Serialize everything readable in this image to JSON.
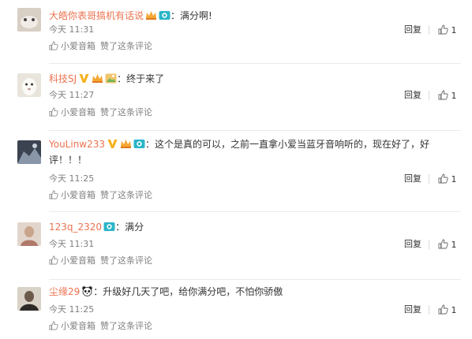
{
  "comments": [
    {
      "username": "大皓你表哥搞机有话说",
      "text": "：满分啊!",
      "time": "今天 11:31",
      "reply": "回复",
      "likes": "1",
      "source": "小爱音箱",
      "liked_label": "赞了这条评论"
    },
    {
      "username": "科技SJ",
      "text": "：终于来了",
      "time": "今天 11:27",
      "reply": "回复",
      "likes": "1",
      "source": "小爱音箱",
      "liked_label": "赞了这条评论"
    },
    {
      "username": "YouLinw233",
      "text": "：这个是真的可以，之前一直拿小爱当蓝牙音响听的，现在好了，好评！！！",
      "time": "今天 11:25",
      "reply": "回复",
      "likes": "1",
      "source": "小爱音箱",
      "liked_label": "赞了这条评论"
    },
    {
      "username": "123q_2320",
      "text": "：满分",
      "time": "今天 11:31",
      "reply": "回复",
      "likes": "1",
      "source": "小爱音箱",
      "liked_label": "赞了这条评论"
    },
    {
      "username": "尘缘29",
      "text": "：升级好几天了吧，给你满分吧，不怕你骄傲",
      "time": "今天 11:25",
      "reply": "回复",
      "likes": "1",
      "source": "小爱音箱",
      "liked_label": "赞了这条评论"
    }
  ],
  "colors": {
    "username": "#eb7350",
    "meta": "#808080",
    "text": "#333333",
    "divider": "#eaeaea"
  },
  "icons": [
    "avatar",
    "verified-v-icon",
    "crown-badge-icon",
    "camera-badge-icon",
    "panda-badge-icon",
    "thumbs-up-icon"
  ]
}
